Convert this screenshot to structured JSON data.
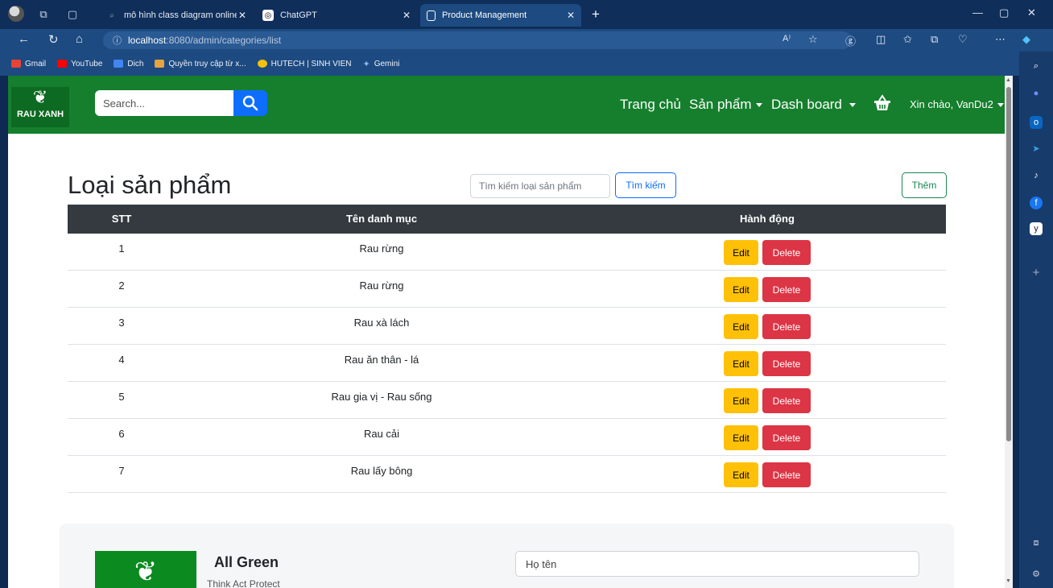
{
  "browser": {
    "tabs": [
      {
        "label": "mô hình class diagram online - T",
        "active": false
      },
      {
        "label": "ChatGPT",
        "active": false
      },
      {
        "label": "Product Management",
        "active": true
      }
    ],
    "url_host": "localhost",
    "url_path": ":8080/admin/categories/list",
    "bookmarks": [
      {
        "label": "Gmail",
        "color": "#ea4335"
      },
      {
        "label": "YouTube",
        "color": "#ff0000"
      },
      {
        "label": "Dich",
        "color": "#4285f4"
      },
      {
        "label": "Quyền truy cập từ x...",
        "color": "#e7a33e"
      },
      {
        "label": "HUTECH | SINH VIEN",
        "color": "#f4c20d"
      },
      {
        "label": "Gemini",
        "color": "#8ab4f8"
      }
    ]
  },
  "navbar": {
    "logo_text": "RAU XANH",
    "search_placeholder": "Search...",
    "items": [
      "Trang chủ",
      "Sản phẩm",
      "Dash board"
    ],
    "greeting": "Xin chào, VanDu2",
    "brand_color": "#157f2d"
  },
  "page": {
    "title": "Loại sản phẩm",
    "search_placeholder": "Tìm kiếm loại sản phẩm",
    "search_button": "Tìm kiếm",
    "add_button": "Thêm"
  },
  "table": {
    "headers": [
      "STT",
      "Tên danh mục",
      "Hành động"
    ],
    "rows": [
      {
        "stt": "1",
        "name": "Rau rừng"
      },
      {
        "stt": "2",
        "name": "Rau rừng"
      },
      {
        "stt": "3",
        "name": "Rau xà lách"
      },
      {
        "stt": "4",
        "name": "Rau ăn thân - lá"
      },
      {
        "stt": "5",
        "name": "Rau gia vị - Rau sống"
      },
      {
        "stt": "6",
        "name": "Rau cải"
      },
      {
        "stt": "7",
        "name": "Rau lấy bông"
      }
    ],
    "edit_label": "Edit",
    "delete_label": "Delete"
  },
  "footer": {
    "brand": "All Green",
    "tagline": "Think Act Protect",
    "name_placeholder": "Họ tên"
  }
}
